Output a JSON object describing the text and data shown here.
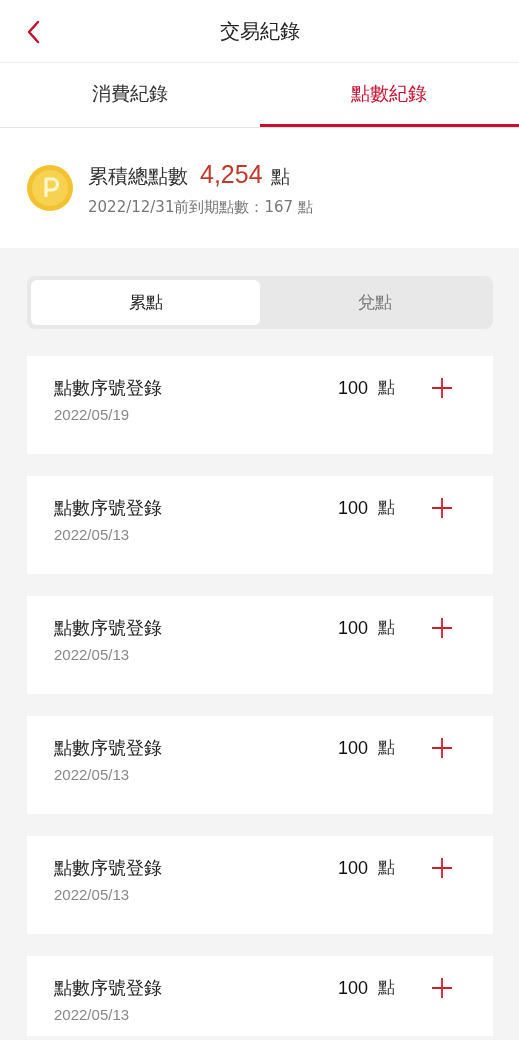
{
  "header": {
    "title": "交易紀錄"
  },
  "tabs": [
    {
      "label": "消費紀錄",
      "selected": false
    },
    {
      "label": "點數紀錄",
      "selected": true
    }
  ],
  "summary": {
    "label": "累積總點數",
    "points": "4,254",
    "unit": "點",
    "expiry": "2022/12/31前到期點數：167 點"
  },
  "segments": [
    {
      "label": "累點",
      "selected": true
    },
    {
      "label": "兌點",
      "selected": false
    }
  ],
  "records": [
    {
      "title": "點數序號登錄",
      "date": "2022/05/19",
      "points": "100",
      "unit": "點"
    },
    {
      "title": "點數序號登錄",
      "date": "2022/05/13",
      "points": "100",
      "unit": "點"
    },
    {
      "title": "點數序號登錄",
      "date": "2022/05/13",
      "points": "100",
      "unit": "點"
    },
    {
      "title": "點數序號登錄",
      "date": "2022/05/13",
      "points": "100",
      "unit": "點"
    },
    {
      "title": "點數序號登錄",
      "date": "2022/05/13",
      "points": "100",
      "unit": "點"
    },
    {
      "title": "點數序號登錄",
      "date": "2022/05/13",
      "points": "100",
      "unit": "點"
    }
  ]
}
